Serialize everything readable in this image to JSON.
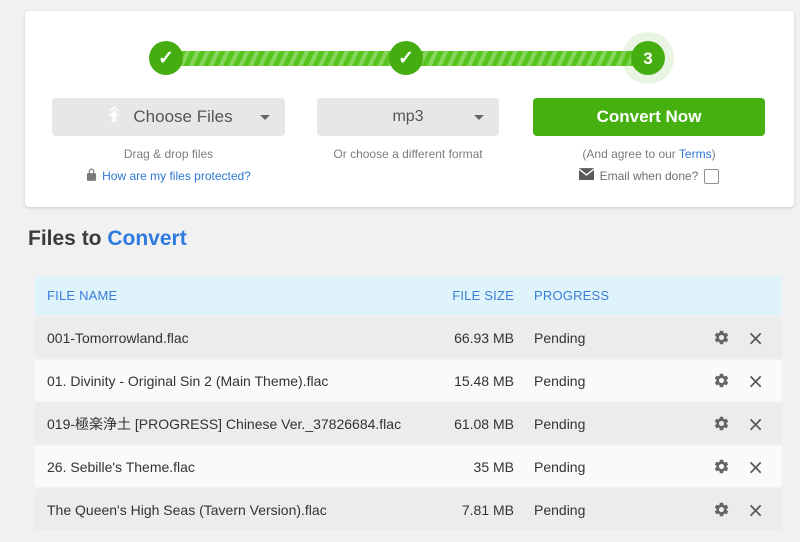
{
  "stepper": {
    "check": "✓",
    "step3_label": "3"
  },
  "actions": {
    "choose_files": "Choose Files",
    "format": "mp3",
    "convert": "Convert Now",
    "drag_hint": "Drag & drop files",
    "format_hint": "Or choose a different format",
    "agree_prefix": "(And agree to our ",
    "terms": "Terms",
    "agree_suffix": ")",
    "protected_link": "How are my files protected?",
    "email_label": "Email when done?"
  },
  "section": {
    "title": "Files to ",
    "title_accent": "Convert"
  },
  "table": {
    "headers": {
      "name": "FILE NAME",
      "size": "FILE SIZE",
      "progress": "PROGRESS"
    },
    "rows": [
      {
        "name": "001-Tomorrowland.flac",
        "size": "66.93 MB",
        "progress": "Pending"
      },
      {
        "name": "01. Divinity - Original Sin 2 (Main Theme).flac",
        "size": "15.48 MB",
        "progress": "Pending"
      },
      {
        "name": "019-極楽浄土 [PROGRESS] Chinese Ver._37826684.flac",
        "size": "61.08 MB",
        "progress": "Pending"
      },
      {
        "name": "26. Sebille's Theme.flac",
        "size": "35 MB",
        "progress": "Pending"
      },
      {
        "name": "The Queen's High Seas (Tavern Version).flac",
        "size": "7.81 MB",
        "progress": "Pending"
      }
    ]
  },
  "icons": {
    "remove": "×"
  },
  "colors": {
    "green": "#47b011",
    "stripe_green": "#58c51e",
    "link_blue": "#2e77d4",
    "header_blue": "#3b7ed9",
    "header_bg": "#dff3fb",
    "row_shade": "#ececec",
    "page_bg": "#f1f1f2"
  }
}
